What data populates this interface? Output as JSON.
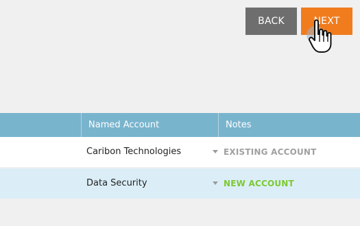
{
  "buttons": {
    "back_label": "BACK",
    "next_label": "NEXT"
  },
  "table": {
    "headers": [
      "",
      "Named Account",
      "Notes"
    ],
    "rows": [
      {
        "account": "Caribon Technologies",
        "note": "EXISTING ACCOUNT",
        "note_color": "#a0a0a0"
      },
      {
        "account": "Data Security",
        "note": "NEW ACCOUNT",
        "note_color": "#7dc832"
      }
    ]
  },
  "colors": {
    "back_button": "#6e6e6e",
    "next_button": "#f07c1e",
    "header_bg": "#79b4cd",
    "row_alt_bg": "#dbeef7",
    "page_bg": "#f0f0f0"
  },
  "icons": {
    "cursor": "hand-pointer-icon",
    "dropdown": "chevron-down-icon"
  }
}
